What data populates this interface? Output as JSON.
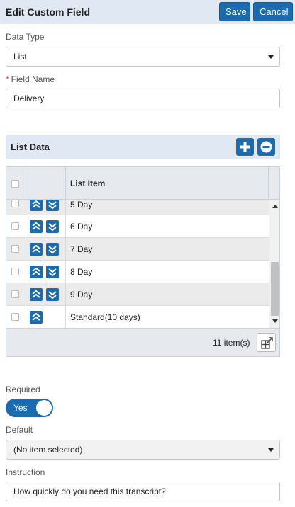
{
  "header": {
    "title": "Edit Custom Field",
    "save_label": "Save",
    "cancel_label": "Cancel"
  },
  "data_type": {
    "label": "Data Type",
    "value": "List"
  },
  "field_name": {
    "label": "Field Name",
    "required_mark": "*",
    "value": "Delivery"
  },
  "list_data": {
    "title": "List Data",
    "add_icon": "plus-icon",
    "remove_icon": "minus-icon",
    "column_header": "List Item",
    "rows": [
      {
        "label": "5 Day",
        "checked": false,
        "move_up": true,
        "move_down": true
      },
      {
        "label": "6 Day",
        "checked": false,
        "move_up": true,
        "move_down": true
      },
      {
        "label": "7 Day",
        "checked": false,
        "move_up": true,
        "move_down": true
      },
      {
        "label": "8 Day",
        "checked": false,
        "move_up": true,
        "move_down": true
      },
      {
        "label": "9 Day",
        "checked": false,
        "move_up": true,
        "move_down": true
      },
      {
        "label": "Standard(10 days)",
        "checked": false,
        "move_up": true,
        "move_down": false
      }
    ],
    "item_count": "11 item(s)"
  },
  "required": {
    "label": "Required",
    "toggle_label": "Yes",
    "on": true
  },
  "default": {
    "label": "Default",
    "value": "(No item selected)"
  },
  "instruction": {
    "label": "Instruction",
    "value": "How quickly do you need this transcript?"
  },
  "colors": {
    "accent": "#1a6bb0",
    "header_bg": "#dfe8f3",
    "required": "#d9534f"
  }
}
